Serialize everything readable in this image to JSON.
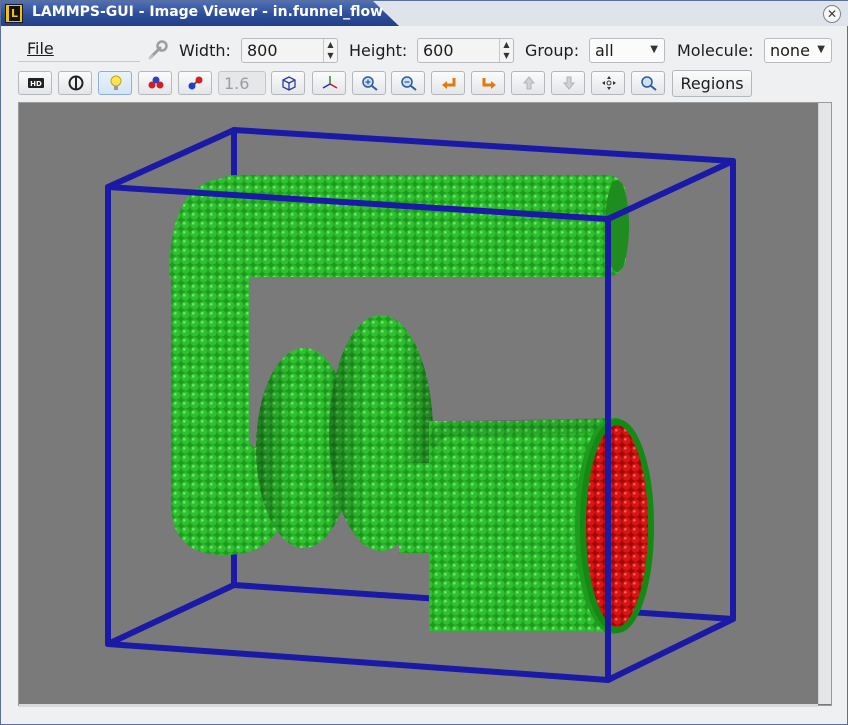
{
  "window": {
    "title": "LAMMPS-GUI - Image Viewer - in.funnel_flow",
    "app_icon_letter": "L",
    "close_glyph": "✕"
  },
  "menu": {
    "file_label": "File"
  },
  "params": {
    "width_label": "Width:",
    "width_value": "800",
    "height_label": "Height:",
    "height_value": "600",
    "group_label": "Group:",
    "group_value": "all",
    "molecule_label": "Molecule:",
    "molecule_value": "none"
  },
  "toolbar": {
    "buttons": [
      {
        "name": "hd-toggle-button",
        "icon": "hd-icon"
      },
      {
        "name": "shiny-toggle-button",
        "icon": "contrast-icon"
      },
      {
        "name": "lighting-toggle-button",
        "icon": "lightbulb-icon",
        "active": true
      },
      {
        "name": "vdw-toggle-button",
        "icon": "atoms-icon"
      },
      {
        "name": "bonds-toggle-button",
        "icon": "molecule-icon"
      },
      {
        "name": "box-toggle-button",
        "icon": "box-icon"
      },
      {
        "name": "axes-toggle-button",
        "icon": "axes-icon"
      },
      {
        "name": "zoom-in-button",
        "icon": "zoom-in-icon"
      },
      {
        "name": "zoom-out-button",
        "icon": "zoom-out-icon"
      },
      {
        "name": "rotate-left-button",
        "icon": "rotate-left-icon"
      },
      {
        "name": "rotate-right-button",
        "icon": "rotate-right-icon"
      },
      {
        "name": "rotate-up-button",
        "icon": "rotate-up-icon"
      },
      {
        "name": "rotate-down-button",
        "icon": "rotate-down-icon"
      },
      {
        "name": "recenter-button",
        "icon": "move-icon"
      },
      {
        "name": "reset-view-button",
        "icon": "magnifier-icon"
      }
    ],
    "zoom_value": "1.6",
    "regions_label": "Regions"
  },
  "colors": {
    "box": "#1a1aa6",
    "atoms_green": "#22b022",
    "atoms_red": "#d01010",
    "background": "#7a7a7a"
  }
}
